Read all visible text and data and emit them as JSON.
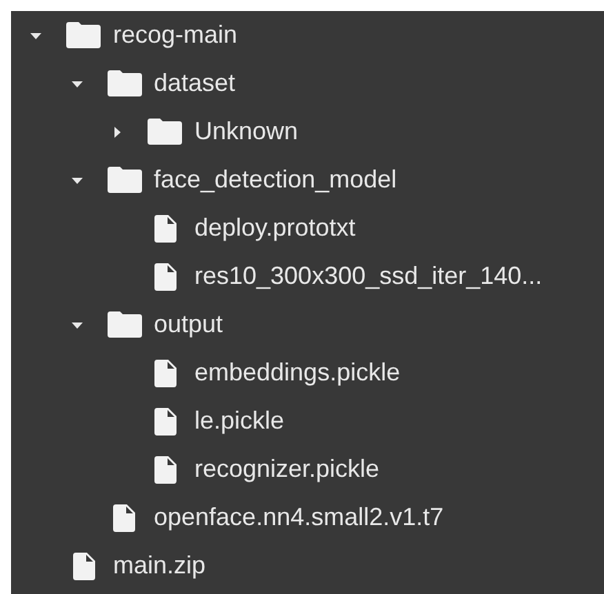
{
  "tree": [
    {
      "kind": "folder",
      "name": "recog-main",
      "expanded": true,
      "children": [
        {
          "kind": "folder",
          "name": "dataset",
          "expanded": true,
          "children": [
            {
              "kind": "folder",
              "name": "Unknown",
              "expanded": false
            }
          ]
        },
        {
          "kind": "folder",
          "name": "face_detection_model",
          "expanded": true,
          "children": [
            {
              "kind": "file",
              "name": "deploy.prototxt"
            },
            {
              "kind": "file",
              "name": "res10_300x300_ssd_iter_140..."
            }
          ]
        },
        {
          "kind": "folder",
          "name": "output",
          "expanded": true,
          "children": [
            {
              "kind": "file",
              "name": "embeddings.pickle"
            },
            {
              "kind": "file",
              "name": "le.pickle"
            },
            {
              "kind": "file",
              "name": "recognizer.pickle"
            }
          ]
        },
        {
          "kind": "file",
          "name": "openface.nn4.small2.v1.t7"
        }
      ]
    },
    {
      "kind": "file",
      "name": "main.zip"
    }
  ]
}
